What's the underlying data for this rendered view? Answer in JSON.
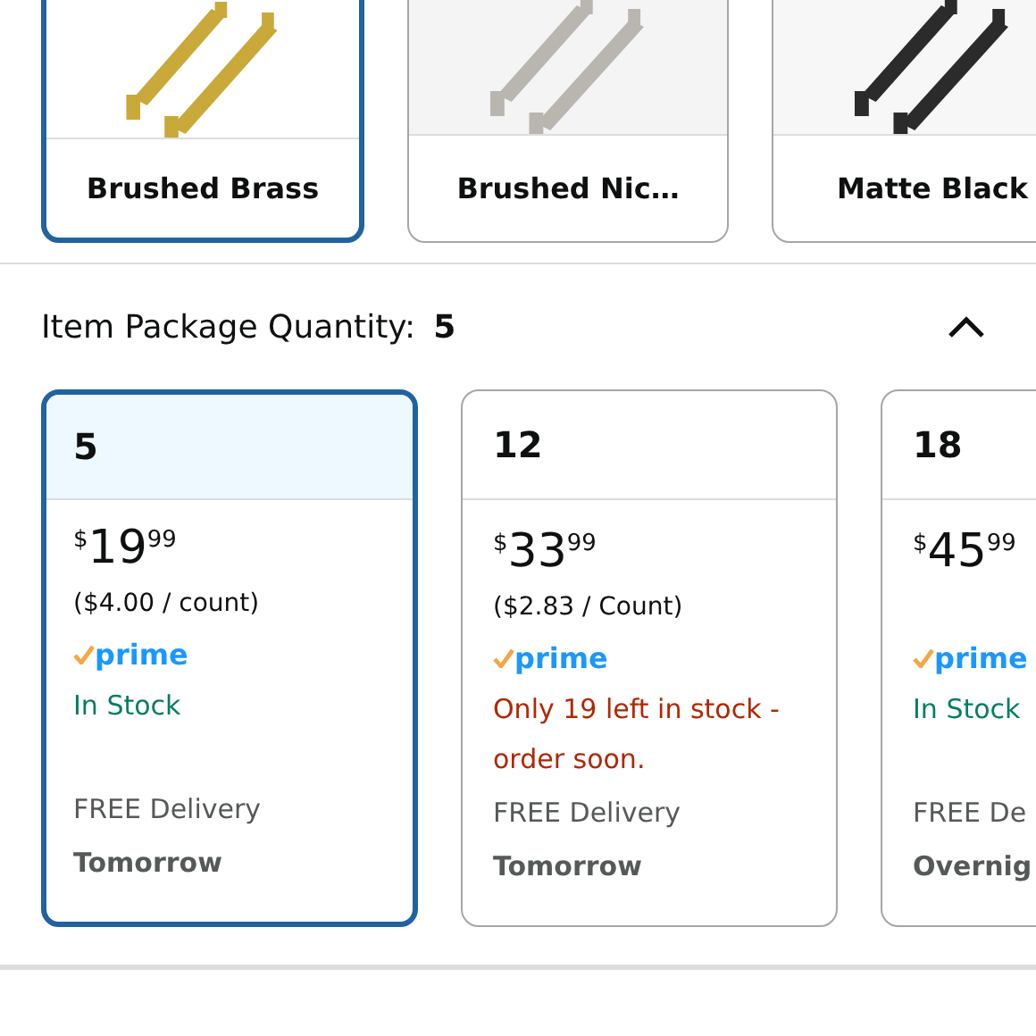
{
  "swatches": [
    {
      "label": "Brushed Brass",
      "selected": true,
      "kind": "picture"
    },
    {
      "label": "Brushed Nic…",
      "selected": false,
      "kind": "picture"
    },
    {
      "label": "Matte Black",
      "selected": false,
      "kind": "picture"
    }
  ],
  "quantity": {
    "label": "Item Package Quantity:",
    "value": "5",
    "expanded": true
  },
  "options": [
    {
      "count": "5",
      "selected": true,
      "price": {
        "symbol": "$",
        "whole": "19",
        "fraction": "99"
      },
      "unit_price": "($4.00 / count)",
      "prime": "prime",
      "stock": {
        "kind": "in_stock",
        "text": "In Stock"
      },
      "delivery": "FREE Delivery",
      "when": "Tomorrow"
    },
    {
      "count": "12",
      "selected": false,
      "price": {
        "symbol": "$",
        "whole": "33",
        "fraction": "99"
      },
      "unit_price": "($2.83 / Count)",
      "prime": "prime",
      "stock": {
        "kind": "low",
        "text": "Only 19 left in stock - order soon."
      },
      "delivery": "FREE Delivery",
      "when": "Tomorrow"
    },
    {
      "count": "18",
      "selected": false,
      "price": {
        "symbol": "$",
        "whole": "45",
        "fraction": "99"
      },
      "prime": "prime",
      "stock": {
        "kind": "in_stock",
        "text": "In Stock"
      },
      "delivery": "FREE De",
      "when": "Overnig"
    }
  ]
}
